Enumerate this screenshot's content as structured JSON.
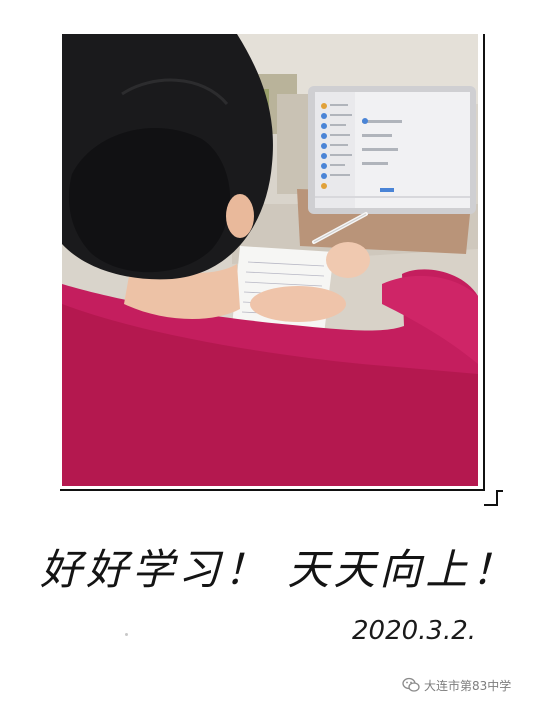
{
  "caption": {
    "slogan": "好好学习！ 天天向上！",
    "date": "2020.3.2."
  },
  "watermark": {
    "icon": "wechat-icon",
    "text": "大连市第83中学"
  },
  "colors": {
    "sweater": "#c41e5e",
    "frame": "#111111"
  }
}
